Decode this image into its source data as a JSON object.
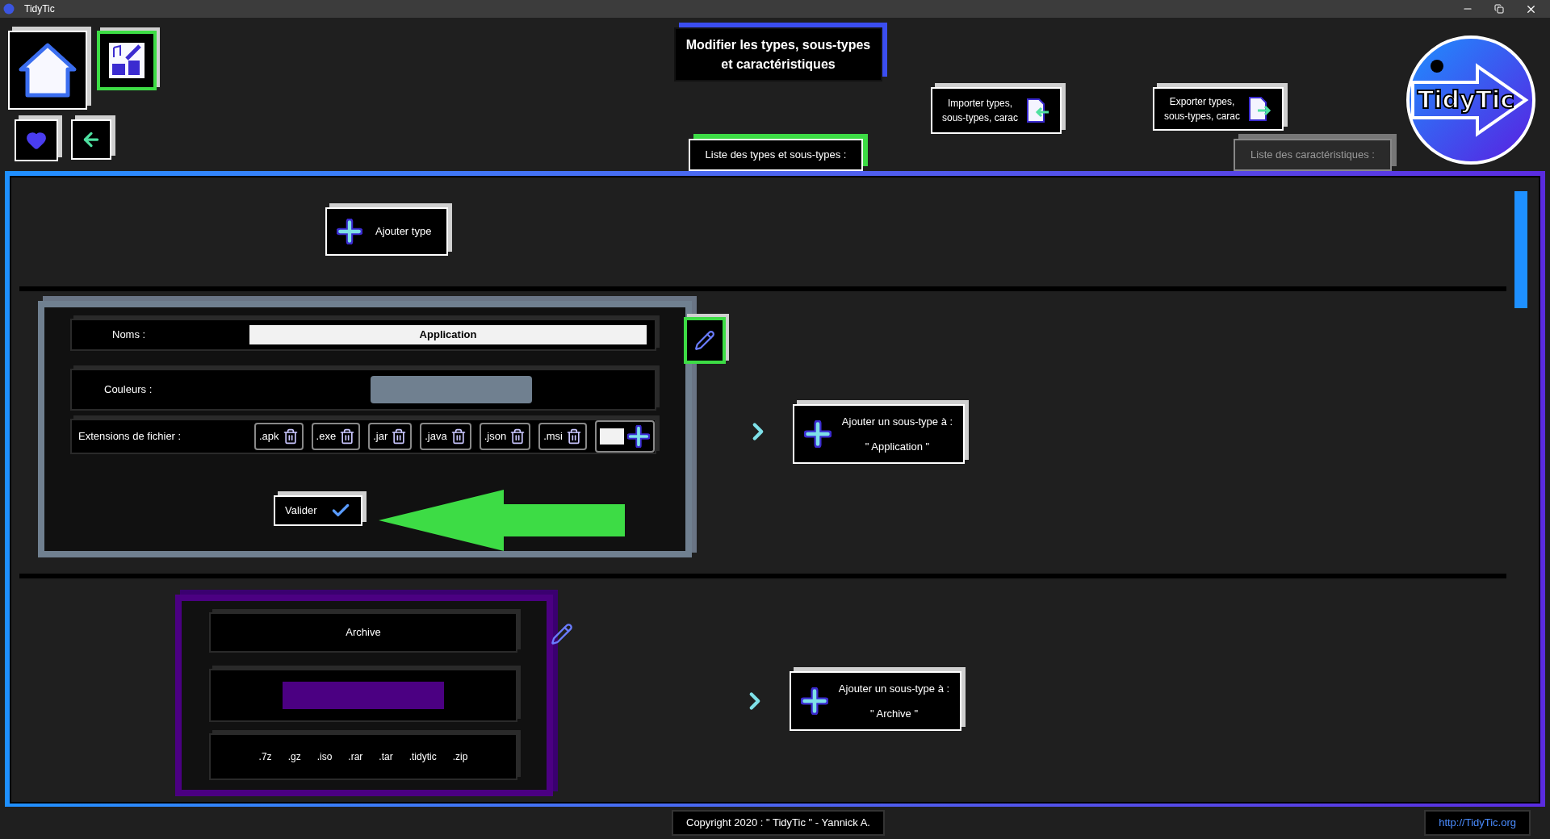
{
  "window": {
    "title": "TidyTic"
  },
  "page_title": "Modifier les types, sous-types\net caractéristiques",
  "import_button": "Importer types,\nsous-types, carac",
  "export_button": "Exporter types,\nsous-types, carac",
  "logo": "TidyTic",
  "tabs": [
    {
      "label": "Liste des types et sous-types :",
      "selected": true
    },
    {
      "label": "Liste des caractéristiques :",
      "selected": false
    }
  ],
  "add_type_button": "Ajouter type",
  "types": [
    {
      "kind": "editing",
      "name": "Application",
      "color": "#708090",
      "name_label": "Noms :",
      "color_label": "Couleurs :",
      "extensions_label": "Extensions de fichier :",
      "extensions": [
        ".apk",
        ".exe",
        ".jar",
        ".java",
        ".json",
        ".msi"
      ],
      "validate_button": "Valider",
      "add_subtype_label": "Ajouter un sous-type à :",
      "add_subtype_target": "\" Application \""
    },
    {
      "kind": "view",
      "name": "Archive",
      "color": "#4b0082",
      "extensions": [
        ".7z",
        ".gz",
        ".iso",
        ".rar",
        ".tar",
        ".tidytic",
        ".zip"
      ],
      "add_subtype_label": "Ajouter un sous-type à :",
      "add_subtype_target": "\" Archive \""
    }
  ],
  "footer": {
    "copyright": "Copyright 2020 : \" TidyTic \" - Yannick A.",
    "link": "http://TidyTic.org"
  }
}
